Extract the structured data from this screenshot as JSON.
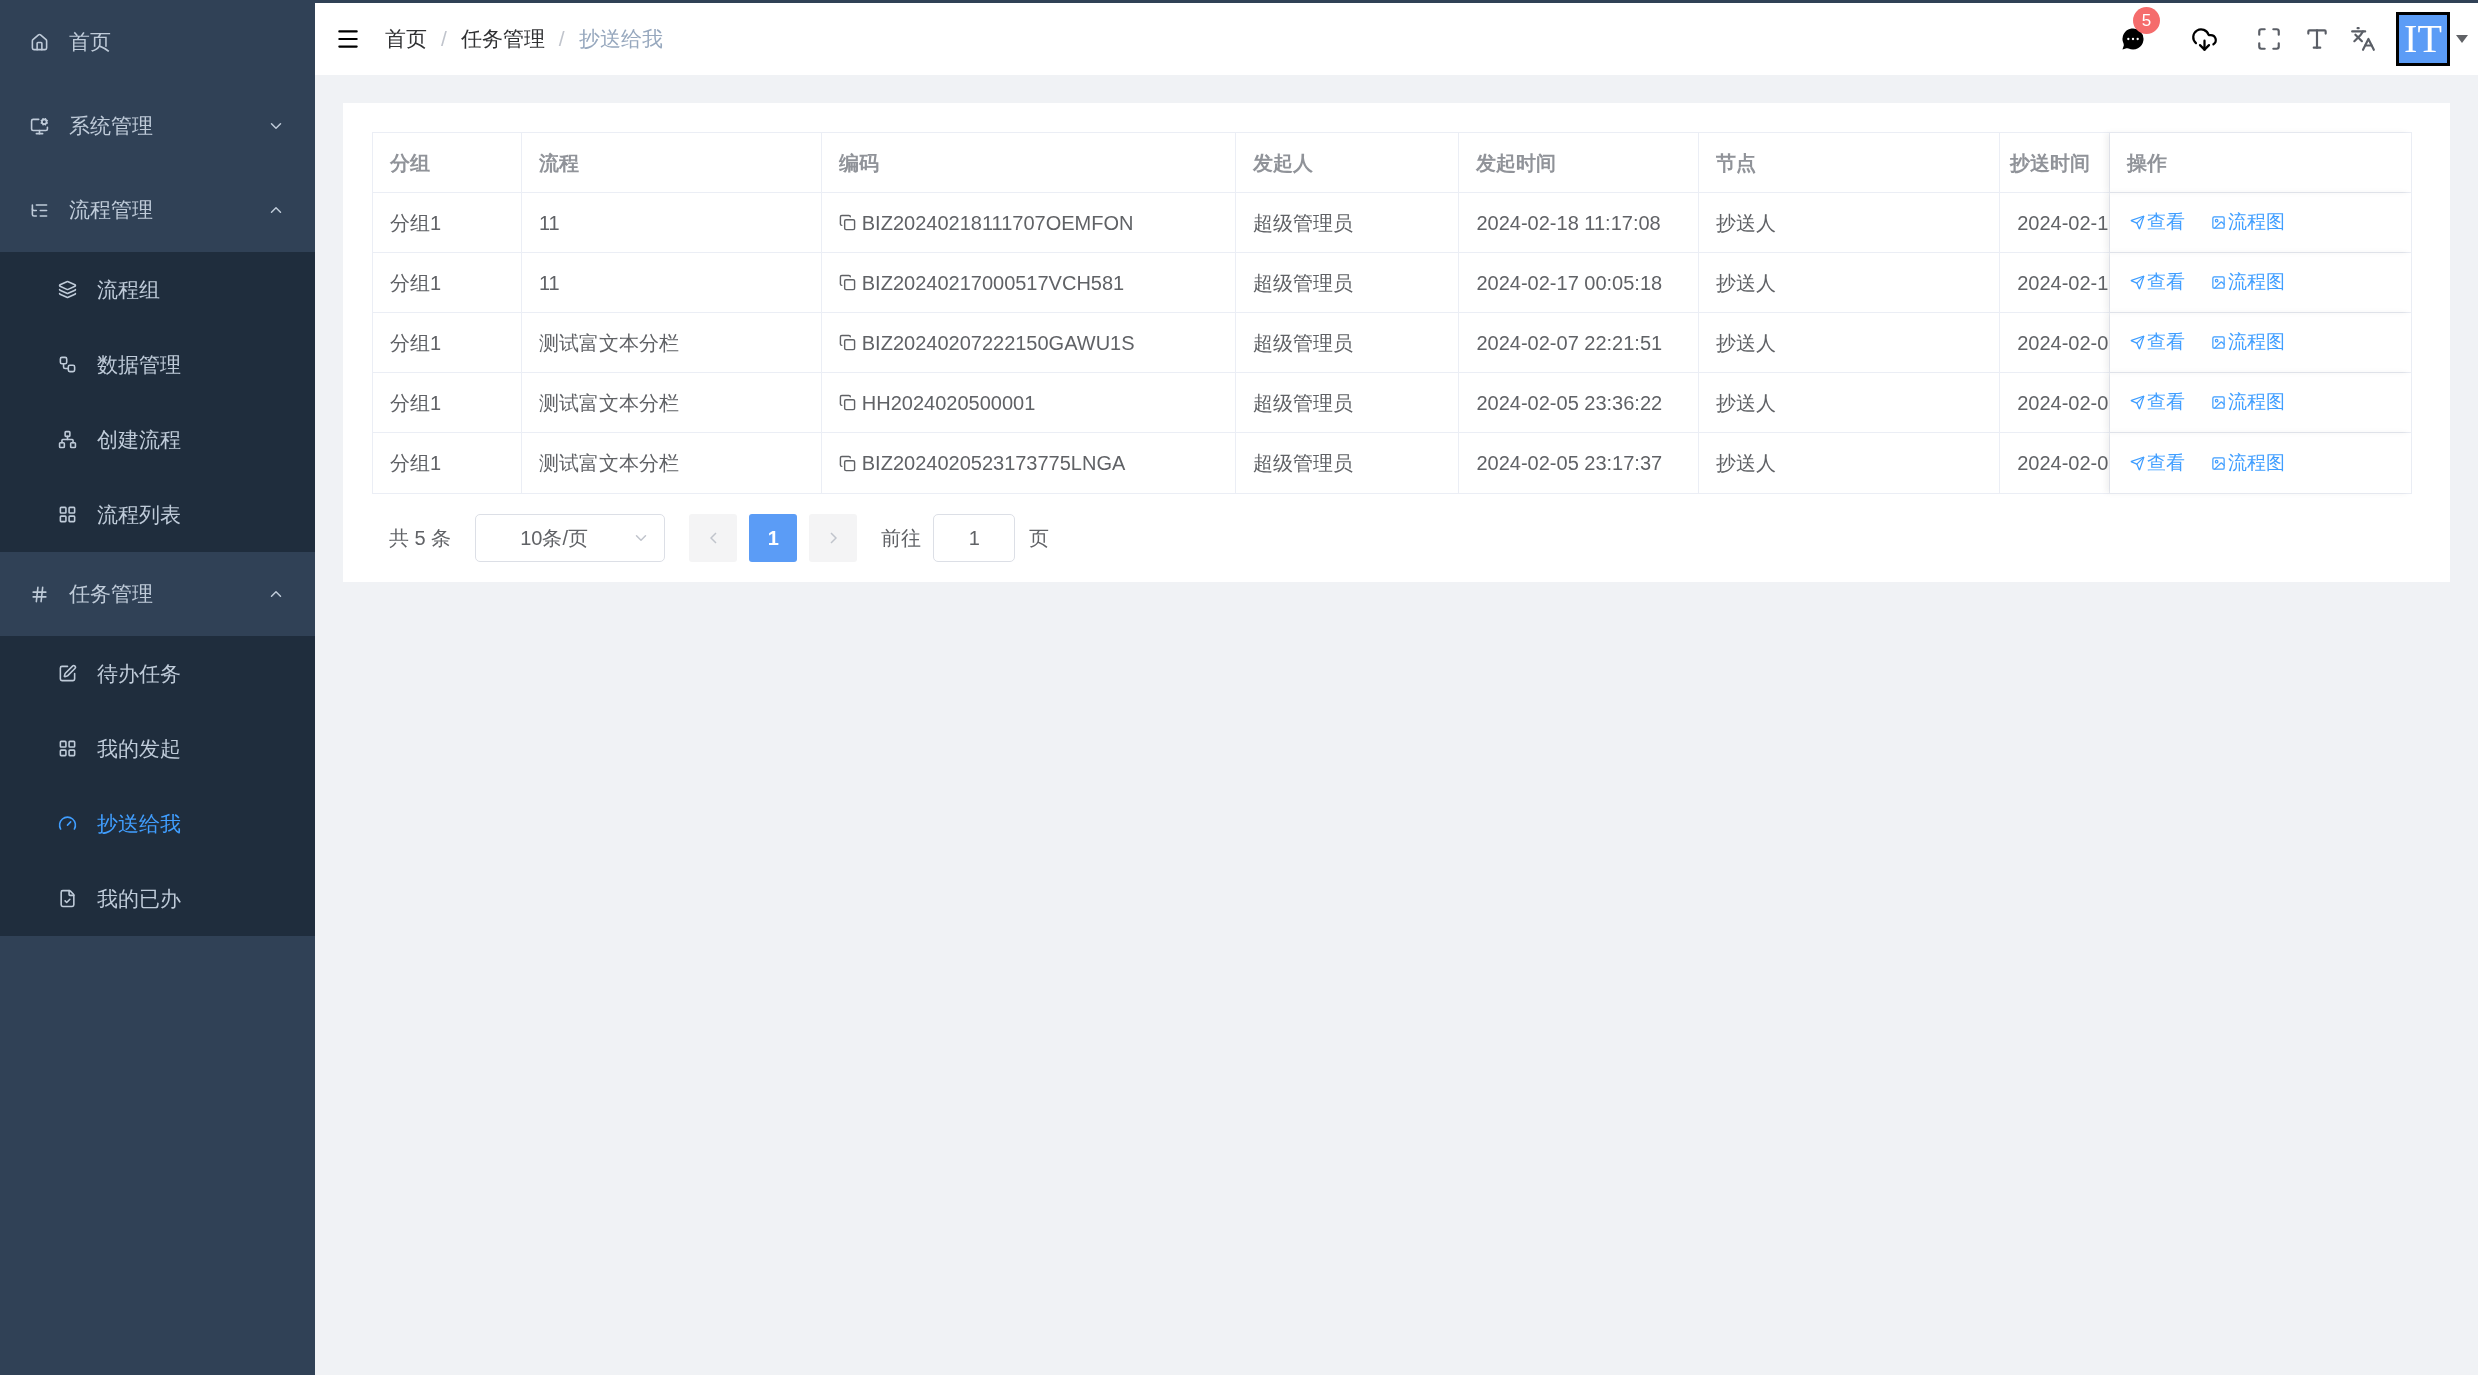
{
  "sidebar": {
    "items": [
      {
        "label": "首页",
        "selected": false
      },
      {
        "label": "系统管理",
        "selected": false,
        "expanded": false
      },
      {
        "label": "流程管理",
        "selected": false,
        "expanded": true,
        "children": [
          {
            "label": "流程组",
            "selected": false
          },
          {
            "label": "数据管理",
            "selected": false
          },
          {
            "label": "创建流程",
            "selected": false
          },
          {
            "label": "流程列表",
            "selected": false
          }
        ]
      },
      {
        "label": "任务管理",
        "selected": false,
        "expanded": true,
        "children": [
          {
            "label": "待办任务",
            "selected": false
          },
          {
            "label": "我的发起",
            "selected": false
          },
          {
            "label": "抄送给我",
            "selected": true
          },
          {
            "label": "我的已办",
            "selected": false
          }
        ]
      }
    ]
  },
  "breadcrumb": {
    "items": [
      "首页",
      "任务管理",
      "抄送给我"
    ],
    "separator": "/"
  },
  "header": {
    "message_badge": "5",
    "avatar": "IT"
  },
  "table": {
    "columns": [
      "分组",
      "流程",
      "编码",
      "发起人",
      "发起时间",
      "节点",
      "抄送时间",
      "操作"
    ],
    "rows": [
      {
        "group": "分组1",
        "flow": "11",
        "code": "BIZ20240218111707OEMFON",
        "starter": "超级管理员",
        "start_time": "2024-02-18 11:17:08",
        "node": "抄送人",
        "cc_time": "2024-02-1",
        "actions": [
          "查看",
          "流程图"
        ]
      },
      {
        "group": "分组1",
        "flow": "11",
        "code": "BIZ20240217000517VCH581",
        "starter": "超级管理员",
        "start_time": "2024-02-17 00:05:18",
        "node": "抄送人",
        "cc_time": "2024-02-1",
        "actions": [
          "查看",
          "流程图"
        ]
      },
      {
        "group": "分组1",
        "flow": "测试富文本分栏",
        "code": "BIZ20240207222150GAWU1S",
        "starter": "超级管理员",
        "start_time": "2024-02-07 22:21:51",
        "node": "抄送人",
        "cc_time": "2024-02-0",
        "actions": [
          "查看",
          "流程图"
        ]
      },
      {
        "group": "分组1",
        "flow": "测试富文本分栏",
        "code": "HH2024020500001",
        "starter": "超级管理员",
        "start_time": "2024-02-05 23:36:22",
        "node": "抄送人",
        "cc_time": "2024-02-0",
        "actions": [
          "查看",
          "流程图"
        ]
      },
      {
        "group": "分组1",
        "flow": "测试富文本分栏",
        "code": "BIZ2024020523173775LNGA",
        "starter": "超级管理员",
        "start_time": "2024-02-05 23:17:37",
        "node": "抄送人",
        "cc_time": "2024-02-0",
        "actions": [
          "查看",
          "流程图"
        ]
      }
    ]
  },
  "pagination": {
    "total": "共 5 条",
    "page_size": "10条/页",
    "pages": [
      {
        "label": "1",
        "selected": true
      }
    ],
    "goto_label": "前往",
    "goto_value": "1",
    "page_suffix": "页"
  }
}
